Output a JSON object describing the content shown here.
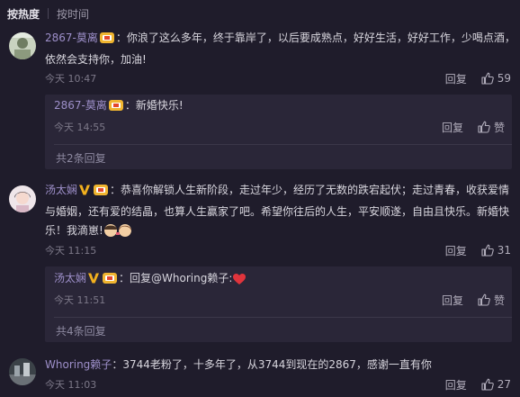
{
  "sort": {
    "hot": "按热度",
    "time": "按时间"
  },
  "comments": [
    {
      "user": "2867-莫离",
      "lines": [
        "：你浪了这么多年，终于靠岸了，以后要成熟点，好好生活，好好工作，少喝点酒，",
        "依然会支持你，加油!"
      ],
      "time": "今天 10:47",
      "reply": "回复",
      "likes": "59",
      "replies": [
        {
          "user": "2867-莫离",
          "text": "：新婚快乐!",
          "time": "今天 14:55",
          "reply": "回复",
          "like": "赞"
        }
      ],
      "more": "共2条回复"
    },
    {
      "user": "汤太娴",
      "lines": [
        "：恭喜你解锁人生新阶段，走过年少，经历了无数的跌宕起伏；走过青春，收获爱情",
        "与婚姻，还有爱的结晶，也算人生赢家了吧。希望你往后的人生，平安顺遂，自由且快乐。新婚快",
        "乐！我滴崽!"
      ],
      "time": "今天 11:15",
      "reply": "回复",
      "likes": "31",
      "replies": [
        {
          "user": "汤太娴",
          "text": "：回复@Whoring赖子:",
          "time": "今天 11:51",
          "reply": "回复",
          "like": "赞"
        }
      ],
      "more": "共4条回复"
    },
    {
      "user": "Whoring赖子",
      "lines": [
        "：3744老粉了，十多年了，从3744到现在的2867，感谢一直有你"
      ],
      "time": "今天 11:03",
      "reply": "回复",
      "likes": "27"
    }
  ],
  "icons": {
    "like": "thumbs-up-icon",
    "badge": "fan-badge-icon",
    "vip": "vip-v-icon",
    "heart": "heart-emoji-icon"
  },
  "colors": {
    "background": "#1f1c2b",
    "subbox": "#2a2638",
    "username": "#9d8fc9",
    "vip": "#f2b01e",
    "heart": "#e0343c"
  }
}
